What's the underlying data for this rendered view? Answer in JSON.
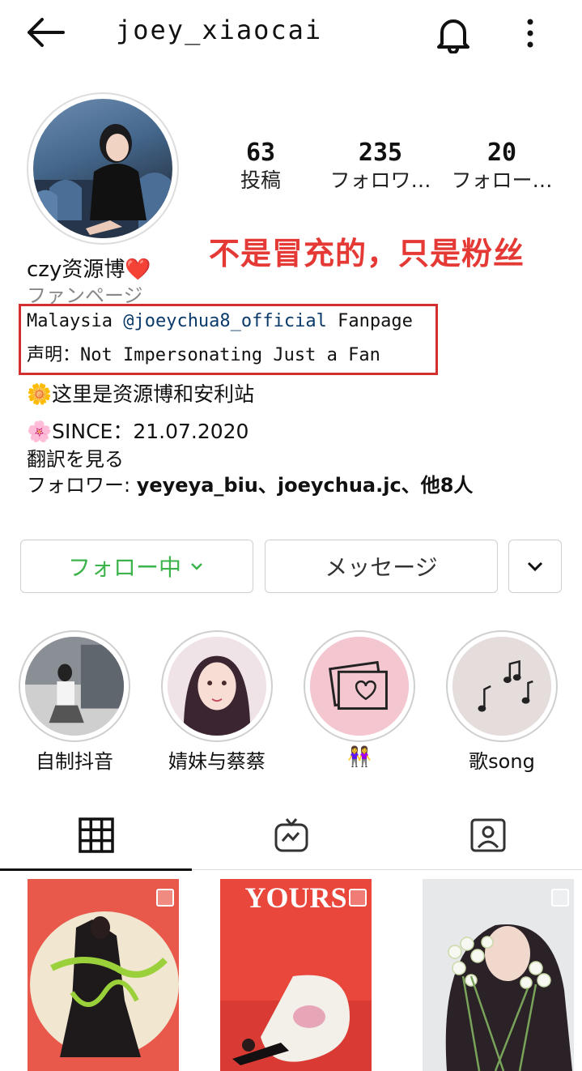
{
  "header": {
    "title": "joey_xiaocai",
    "back_icon": "arrow-left-icon",
    "bell_icon": "bell-icon",
    "more_icon": "more-vertical-icon"
  },
  "stats": [
    {
      "count": "63",
      "label": "投稿"
    },
    {
      "count": "235",
      "label": "フォロワ…"
    },
    {
      "count": "20",
      "label": "フォロー…"
    }
  ],
  "annotation": {
    "text": "不是冒充的，只是粉丝",
    "color": "#e53935"
  },
  "bio": {
    "name": "czy资源博❤️",
    "category": "ファンページ",
    "line1_prefix": "Malaysia ",
    "line1_mention": "@joeychua8_official",
    "line1_suffix": " Fanpage",
    "line2": "声明：Not Impersonating Just a Fan",
    "line3": "🌼这里是资源博和安利站",
    "line4": "🌸SINCE：21.07.2020",
    "translate": "翻訳を見る",
    "followers_prefix": "フォロワー: ",
    "followers_names": "yeyeya_biu、joeychua.jc、他8人"
  },
  "actions": {
    "follow": "フォロー中",
    "message": "メッセージ",
    "follow_color": "#3cb44b"
  },
  "highlights": [
    {
      "label": "自制抖音"
    },
    {
      "label": "婧妹与蔡蔡"
    },
    {
      "label": "👭"
    },
    {
      "label": "歌song"
    }
  ],
  "tabs": [
    {
      "icon": "grid-icon"
    },
    {
      "icon": "igtv-icon"
    },
    {
      "icon": "tagged-icon"
    }
  ],
  "posts": [
    {
      "caption": ""
    },
    {
      "caption": "YOURS"
    },
    {
      "caption": ""
    }
  ]
}
